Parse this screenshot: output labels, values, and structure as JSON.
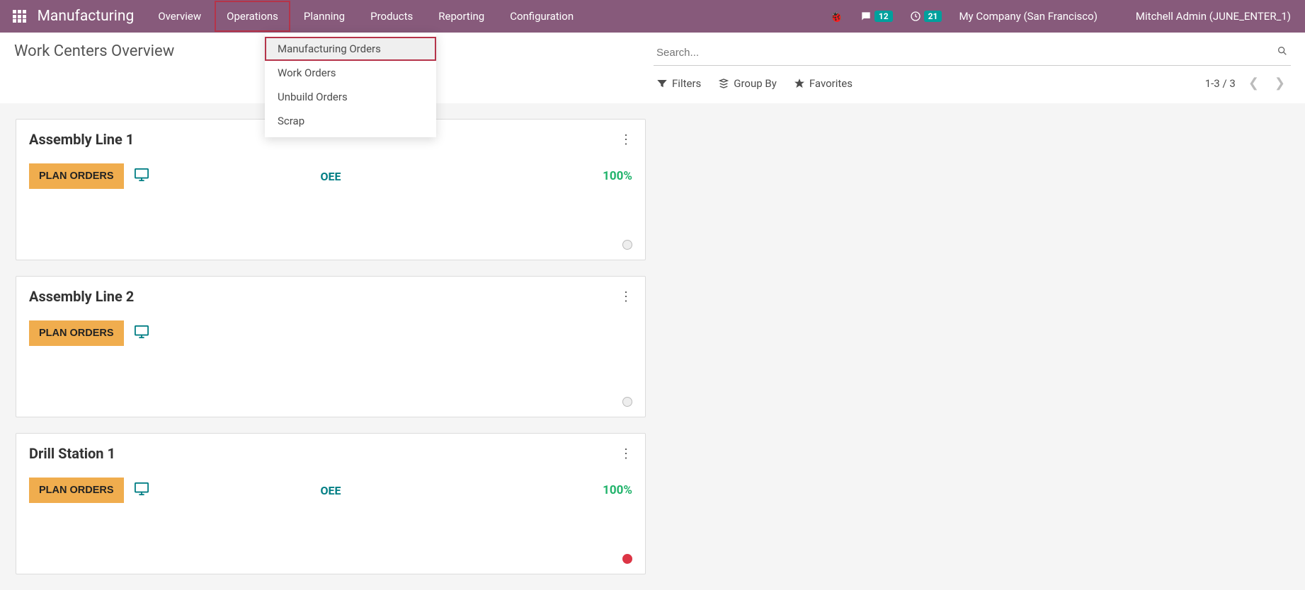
{
  "navbar": {
    "brand": "Manufacturing",
    "menu": [
      "Overview",
      "Operations",
      "Planning",
      "Products",
      "Reporting",
      "Configuration"
    ],
    "active_menu_index": 1,
    "messages_count": "12",
    "activity_count": "21",
    "company": "My Company (San Francisco)",
    "user": "Mitchell Admin (JUNE_ENTER_1)"
  },
  "dropdown": {
    "items": [
      "Manufacturing Orders",
      "Work Orders",
      "Unbuild Orders",
      "Scrap"
    ],
    "highlighted_index": 0
  },
  "control": {
    "title": "Work Centers Overview",
    "search_placeholder": "Search...",
    "filters_label": "Filters",
    "groupby_label": "Group By",
    "favorites_label": "Favorites",
    "pager": "1-3 / 3"
  },
  "cards": {
    "col1": [
      {
        "title": "Assembly Line 1",
        "plan_label": "PLAN ORDERS",
        "oee_label": "OEE",
        "oee_value": "100%",
        "show_oee": true,
        "dot": "grey"
      },
      {
        "title": "Assembly Line 2",
        "plan_label": "PLAN ORDERS",
        "oee_label": "",
        "oee_value": "",
        "show_oee": false,
        "dot": "grey"
      }
    ],
    "col2": [
      {
        "title": "Drill Station 1",
        "plan_label": "PLAN ORDERS",
        "oee_label": "OEE",
        "oee_value": "100%",
        "show_oee": true,
        "dot": "red"
      }
    ]
  }
}
